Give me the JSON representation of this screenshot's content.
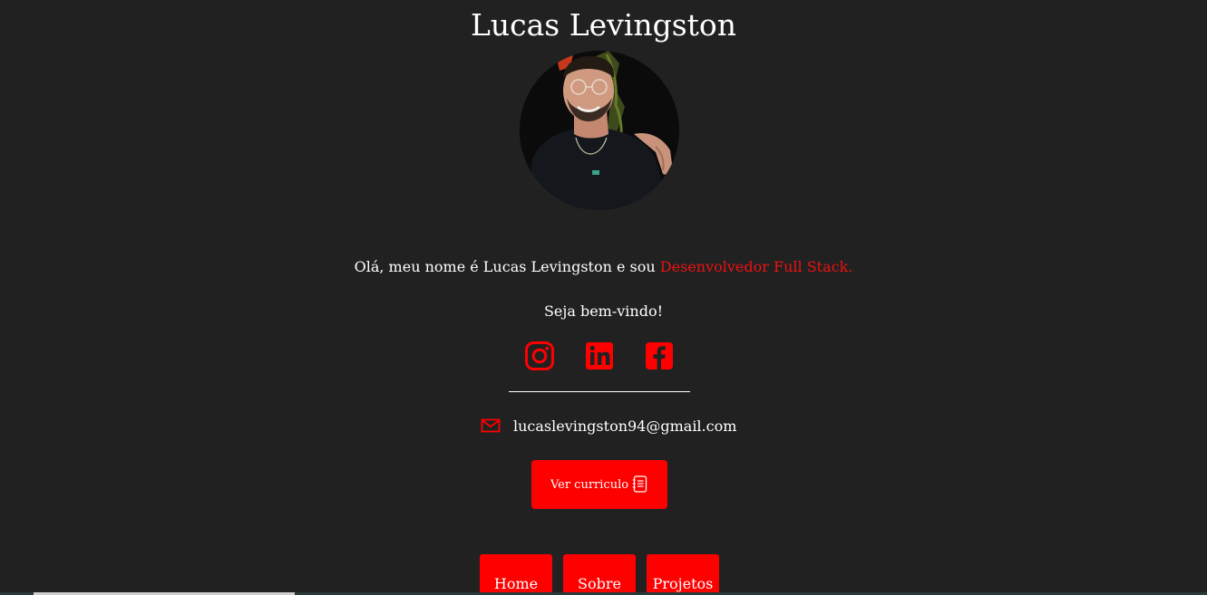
{
  "profile": {
    "name": "Lucas Levingston",
    "avatar_alt": "Lucas Levingston"
  },
  "intro": {
    "text": "Olá, meu nome é Lucas Levingston e sou ",
    "role": "Desenvolvedor Full Stack."
  },
  "welcome": "Seja bem-vindo!",
  "social": [
    {
      "name": "instagram-icon"
    },
    {
      "name": "linkedin-icon"
    },
    {
      "name": "facebook-icon"
    }
  ],
  "contact": {
    "email": "lucaslevingston94@gmail.com",
    "icon": "mail-icon"
  },
  "cv_button": {
    "label": "Ver curriculo",
    "icon": "document-icon"
  },
  "nav": [
    {
      "label": "Home"
    },
    {
      "label": "Sobre"
    },
    {
      "label": "Projetos"
    }
  ],
  "colors": {
    "accent": "#ff0000",
    "background": "#212121",
    "text": "#ffffff"
  }
}
